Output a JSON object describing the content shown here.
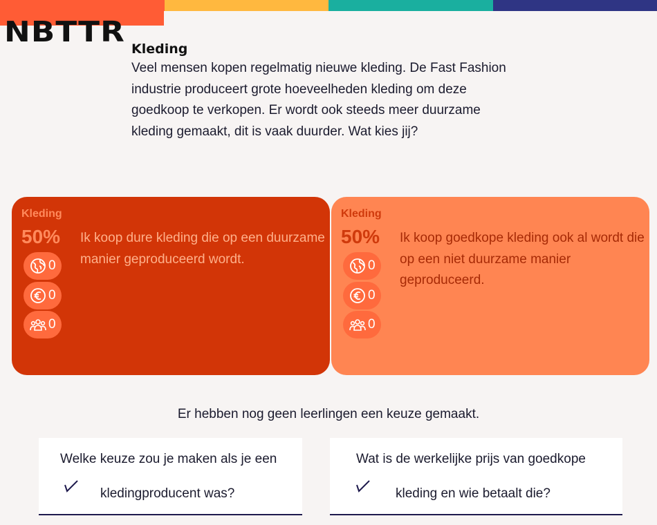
{
  "brand": {
    "logo": "NBTTR",
    "stripe_colors": [
      "#ff5c35",
      "#ffb83f",
      "#1aaf9f",
      "#2f3584"
    ]
  },
  "intro": {
    "title": "Kleding",
    "body": "Veel mensen kopen regelmatig nieuwe kleding. De Fast Fashion industrie produceert grote hoeveelheden kleding om deze goedkoop te verkopen. Er wordt ook steeds meer duurzame kleding gemaakt, dit is vaak duurder. Wat kies jij?"
  },
  "choices": [
    {
      "label": "Kleding",
      "percent": "50%",
      "text": "Ik koop dure kleding die op een duurzame manier geproduceerd wordt.",
      "metrics": [
        {
          "icon": "globe-icon",
          "value": "0"
        },
        {
          "icon": "euro-coin-icon",
          "value": "0"
        },
        {
          "icon": "people-group-icon",
          "value": "0"
        }
      ],
      "colors": {
        "background": "#d23507",
        "label": "#ff8a5c",
        "text": "#ffb08a",
        "badge": "#ff6a3d",
        "icon": "#ffffff"
      }
    },
    {
      "label": "Kleding",
      "percent": "50%",
      "text": "Ik koop goedkope kleding ook al wordt die op een niet duurzame manier geproduceerd.",
      "metrics": [
        {
          "icon": "globe-icon",
          "value": "0"
        },
        {
          "icon": "euro-coin-icon",
          "value": "0"
        },
        {
          "icon": "people-group-icon",
          "value": "0"
        }
      ],
      "colors": {
        "background": "#ff8552",
        "label": "#cf3a0c",
        "text": "#a72a06",
        "badge": "#ff6a3d",
        "icon": "#ffffff"
      }
    }
  ],
  "status": "Er hebben nog geen leerlingen een keuze gemaakt.",
  "questions": [
    {
      "line1": "Welke keuze zou je maken als je een",
      "line2": "kledingproducent was?"
    },
    {
      "line1": "Wat is de werkelijke prijs van goedkope",
      "line2": "kleding en wie betaalt die?"
    }
  ]
}
